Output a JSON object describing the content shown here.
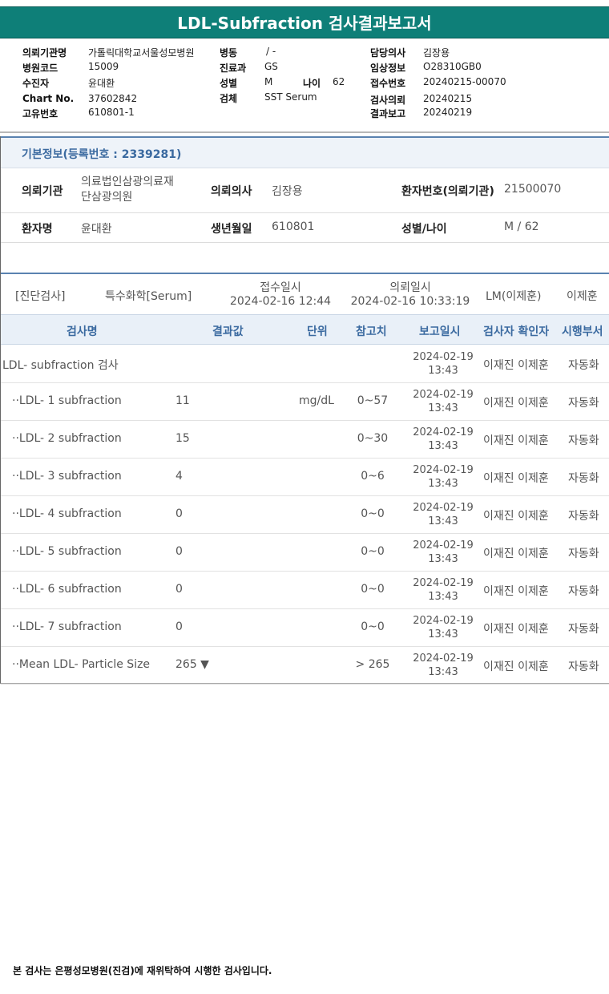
{
  "report": {
    "title": "LDL-Subfraction 검사결과보고서"
  },
  "header": {
    "institution_label": "의뢰기관명",
    "institution_value": "가톨릭대학교서울성모병원",
    "hospital_code_label": "병원코드",
    "hospital_code_value": "15009",
    "patient_label": "수진자",
    "patient_value": "윤대환",
    "chart_label": "Chart No.",
    "chart_value": "37602842",
    "unique_label": "고유번호",
    "unique_value": "610801-1",
    "ward_label": "병동",
    "ward_value": "/ -",
    "dept_label": "진료과",
    "dept_value": "GS",
    "sex_label": "성별",
    "sex_value": "M",
    "age_label": "나이",
    "age_value": "62",
    "specimen_label": "검체",
    "specimen_value": "SST Serum",
    "doctor_label": "담당의사",
    "doctor_value": "김장용",
    "clinical_label": "임상정보",
    "clinical_value": "O28310GB0",
    "receipt_label": "접수번호",
    "receipt_value": "20240215-00070",
    "request_label": "검사의뢰",
    "request_value": "20240215",
    "result_label": "결과보고",
    "result_value": "20240219"
  },
  "basic": {
    "heading": "기본정보(등록번호 : 2339281)",
    "inst_label": "의뢰기관",
    "inst_value_line1": "의료법인삼광의료재",
    "inst_value_line2": "단삼광의원",
    "doc_label": "의뢰의사",
    "doc_value": "김장용",
    "pid_label": "환자번호(의뢰기관)",
    "pid_value": "21500070",
    "name_label": "환자명",
    "name_value": "윤대환",
    "dob_label": "생년월일",
    "dob_value": "610801",
    "sexage_label": "성별/나이",
    "sexage_value": "M / 62"
  },
  "diagnosis": {
    "type": "[진단검사]",
    "category": "특수화학[Serum]",
    "receipt_label": "접수일시",
    "receipt_value": "2024-02-16 12:44",
    "request_label": "의뢰일시",
    "request_value": "2024-02-16 10:33:19",
    "lm": "LM(이제훈)",
    "person": "이제훈"
  },
  "table": {
    "headers": {
      "name": "검사명",
      "result": "결과값",
      "unit": "단위",
      "ref": "참고치",
      "date": "보고일시",
      "confirmer": "검사자 확인자",
      "dept": "시행부서"
    },
    "rows": [
      {
        "name": "LDL- subfraction 검사",
        "value": "",
        "unit": "",
        "ref": "",
        "date": "2024-02-19",
        "time": "13:43",
        "who": "이재진 이제훈",
        "dept": "자동화"
      },
      {
        "name": "··LDL- 1 subfraction",
        "value": "11",
        "unit": "mg/dL",
        "ref": "0~57",
        "date": "2024-02-19",
        "time": "13:43",
        "who": "이재진 이제훈",
        "dept": "자동화"
      },
      {
        "name": "··LDL- 2 subfraction",
        "value": "15",
        "unit": "",
        "ref": "0~30",
        "date": "2024-02-19",
        "time": "13:43",
        "who": "이재진 이제훈",
        "dept": "자동화"
      },
      {
        "name": "··LDL- 3 subfraction",
        "value": "4",
        "unit": "",
        "ref": "0~6",
        "date": "2024-02-19",
        "time": "13:43",
        "who": "이재진 이제훈",
        "dept": "자동화"
      },
      {
        "name": "··LDL- 4 subfraction",
        "value": "0",
        "unit": "",
        "ref": "0~0",
        "date": "2024-02-19",
        "time": "13:43",
        "who": "이재진 이제훈",
        "dept": "자동화"
      },
      {
        "name": "··LDL- 5 subfraction",
        "value": "0",
        "unit": "",
        "ref": "0~0",
        "date": "2024-02-19",
        "time": "13:43",
        "who": "이재진 이제훈",
        "dept": "자동화"
      },
      {
        "name": "··LDL- 6 subfraction",
        "value": "0",
        "unit": "",
        "ref": "0~0",
        "date": "2024-02-19",
        "time": "13:43",
        "who": "이재진 이제훈",
        "dept": "자동화"
      },
      {
        "name": "··LDL- 7 subfraction",
        "value": "0",
        "unit": "",
        "ref": "0~0",
        "date": "2024-02-19",
        "time": "13:43",
        "who": "이재진 이제훈",
        "dept": "자동화"
      },
      {
        "name": "··Mean LDL- Particle Size",
        "value": "265 ▼",
        "unit": "",
        "ref": "> 265",
        "date": "2024-02-19",
        "time": "13:43",
        "who": "이재진 이제훈",
        "dept": "자동화"
      }
    ]
  },
  "footer": {
    "note": "본 검사는 은평성모병원(진검)에 재위탁하여 시행한 검사입니다."
  }
}
